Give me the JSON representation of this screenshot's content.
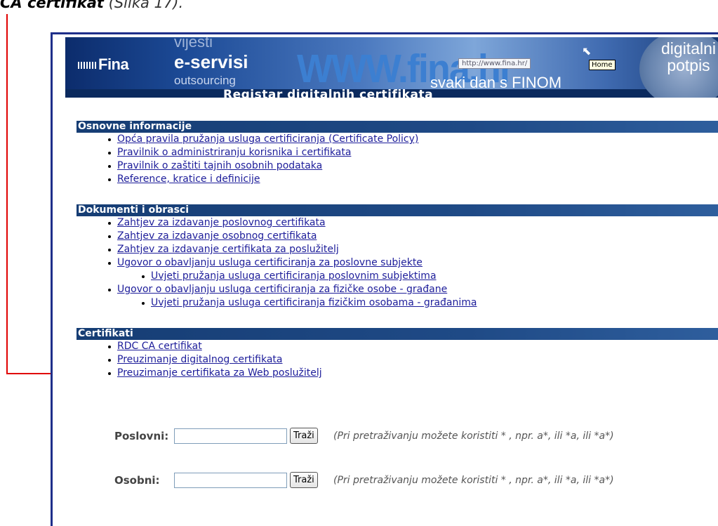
{
  "caption": {
    "bold": "CA certifikat",
    "rest": " (Slika 17)."
  },
  "banner": {
    "logo_text": "Fina",
    "menu": [
      "vijesti",
      "e-servisi",
      "outsourcing"
    ],
    "site": "WWW.fina.hr",
    "address_bar": "http://www.fina.hr/",
    "tooltip": "Home",
    "slogan": "svaki dan s FINOM",
    "right_brand": "digitalni potpis",
    "title": "Registar digitalnih certifikata"
  },
  "sections": [
    {
      "title": "Osnovne informacije",
      "links": [
        {
          "label": "Opća pravila pružanja usluga certificiranja (Certificate Policy)",
          "sub": false
        },
        {
          "label": "Pravilnik o administriranju korisnika i certifikata",
          "sub": false
        },
        {
          "label": "Pravilnik o zaštiti tajnih osobnih podataka",
          "sub": false
        },
        {
          "label": "Reference, kratice i definicije",
          "sub": false
        }
      ]
    },
    {
      "title": "Dokumenti i obrasci",
      "links": [
        {
          "label": "Zahtjev za izdavanje poslovnog certifikata",
          "sub": false
        },
        {
          "label": "Zahtjev za izdavanje osobnog certifikata",
          "sub": false
        },
        {
          "label": "Zahtjev za izdavanje certifikata za poslužitelj",
          "sub": false
        },
        {
          "label": "Ugovor o obavljanju usluga certificiranja za poslovne subjekte",
          "sub": false
        },
        {
          "label": "Uvjeti pružanja usluga certificiranja poslovnim subjektima",
          "sub": true
        },
        {
          "label": "Ugovor o obavljanju usluga certificiranja za fizičke osobe - građane",
          "sub": false
        },
        {
          "label": "Uvjeti pružanja usluga certificiranja fizičkim osobama - građanima",
          "sub": true
        }
      ]
    },
    {
      "title": "Certifikati",
      "links": [
        {
          "label": "RDC CA certifikat",
          "sub": false
        },
        {
          "label": "Preuzimanje digitalnog certifikata",
          "sub": false
        },
        {
          "label": "Preuzimanje certifikata za Web poslužitelj",
          "sub": false
        }
      ]
    }
  ],
  "search": [
    {
      "label": "Poslovni:",
      "value": "",
      "button": "Traži",
      "hint": "(Pri pretraživanju možete koristiti * , npr. a*, ili *a, ili *a*)"
    },
    {
      "label": "Osobni:",
      "value": "",
      "button": "Traži",
      "hint": "(Pri pretraživanju možete koristiti * , npr. a*, ili *a, ili *a*)"
    }
  ],
  "colors": {
    "section_bar": "#1f4a86",
    "link": "#1d1d9a",
    "arrow": "#e00000",
    "frame": "#1f2f8a"
  },
  "icons": [
    "cursor-icon",
    "arrow-pointer"
  ]
}
